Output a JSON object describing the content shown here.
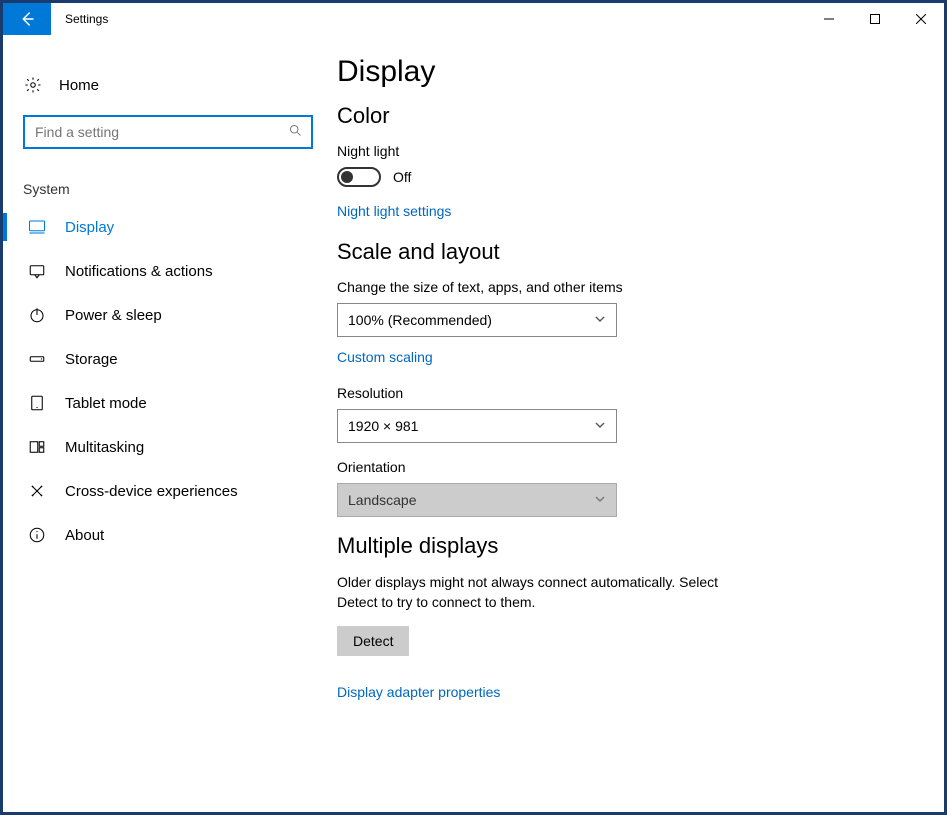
{
  "window": {
    "title": "Settings"
  },
  "sidebar": {
    "home": "Home",
    "search_placeholder": "Find a setting",
    "section": "System",
    "items": [
      {
        "label": "Display"
      },
      {
        "label": "Notifications & actions"
      },
      {
        "label": "Power & sleep"
      },
      {
        "label": "Storage"
      },
      {
        "label": "Tablet mode"
      },
      {
        "label": "Multitasking"
      },
      {
        "label": "Cross-device experiences"
      },
      {
        "label": "About"
      }
    ]
  },
  "page": {
    "title": "Display",
    "color": {
      "heading": "Color",
      "night_light_label": "Night light",
      "night_light_state": "Off",
      "night_light_settings_link": "Night light settings"
    },
    "scale": {
      "heading": "Scale and layout",
      "size_label": "Change the size of text, apps, and other items",
      "size_value": "100% (Recommended)",
      "custom_scaling_link": "Custom scaling",
      "resolution_label": "Resolution",
      "resolution_value": "1920 × 981",
      "orientation_label": "Orientation",
      "orientation_value": "Landscape"
    },
    "multi": {
      "heading": "Multiple displays",
      "desc": "Older displays might not always connect automatically. Select Detect to try to connect to them.",
      "detect_button": "Detect",
      "adapter_link": "Display adapter properties"
    }
  }
}
